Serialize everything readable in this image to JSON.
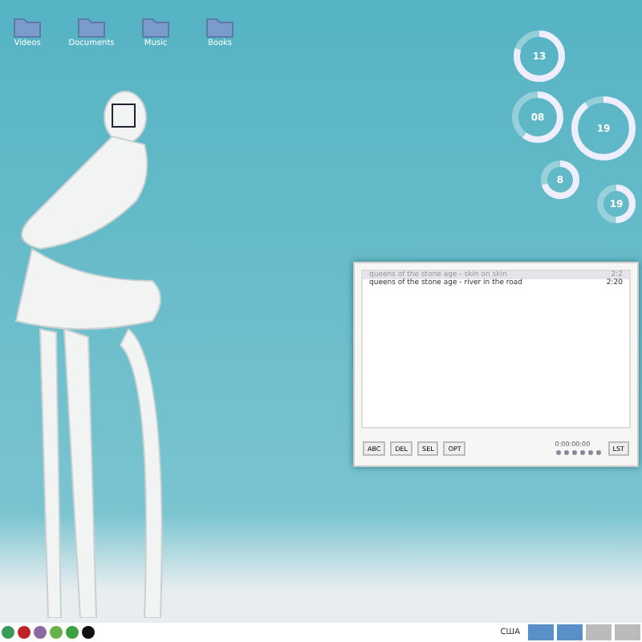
{
  "desktop_icons": [
    {
      "label": "Videos"
    },
    {
      "label": "Documents"
    },
    {
      "label": "Music"
    },
    {
      "label": "Books"
    }
  ],
  "gauges": [
    {
      "value": "13",
      "level": 0.8
    },
    {
      "value": "08",
      "level": 0.6
    },
    {
      "value": "19",
      "level": 0.9
    },
    {
      "value": "8",
      "level": 0.7
    },
    {
      "value": "19",
      "level": 0.5
    }
  ],
  "player": {
    "tracks": [
      {
        "title": "queens of the stone age - skin on skin",
        "duration": "2:2",
        "selected": true
      },
      {
        "title": "queens of the stone age - river in the road",
        "duration": "2:20",
        "selected": false
      }
    ],
    "buttons": [
      "ABC",
      "DEL",
      "SEL",
      "OPT"
    ],
    "time": "0:00:00:00",
    "extra": "LST"
  },
  "taskbar": {
    "apps": [
      {
        "color": "#3a9a5a"
      },
      {
        "color": "#c0222a"
      },
      {
        "color": "#8a6aa0"
      },
      {
        "color": "#6ab04a"
      },
      {
        "color": "#3aa040"
      },
      {
        "color": "#111111"
      }
    ],
    "layout": "США"
  }
}
